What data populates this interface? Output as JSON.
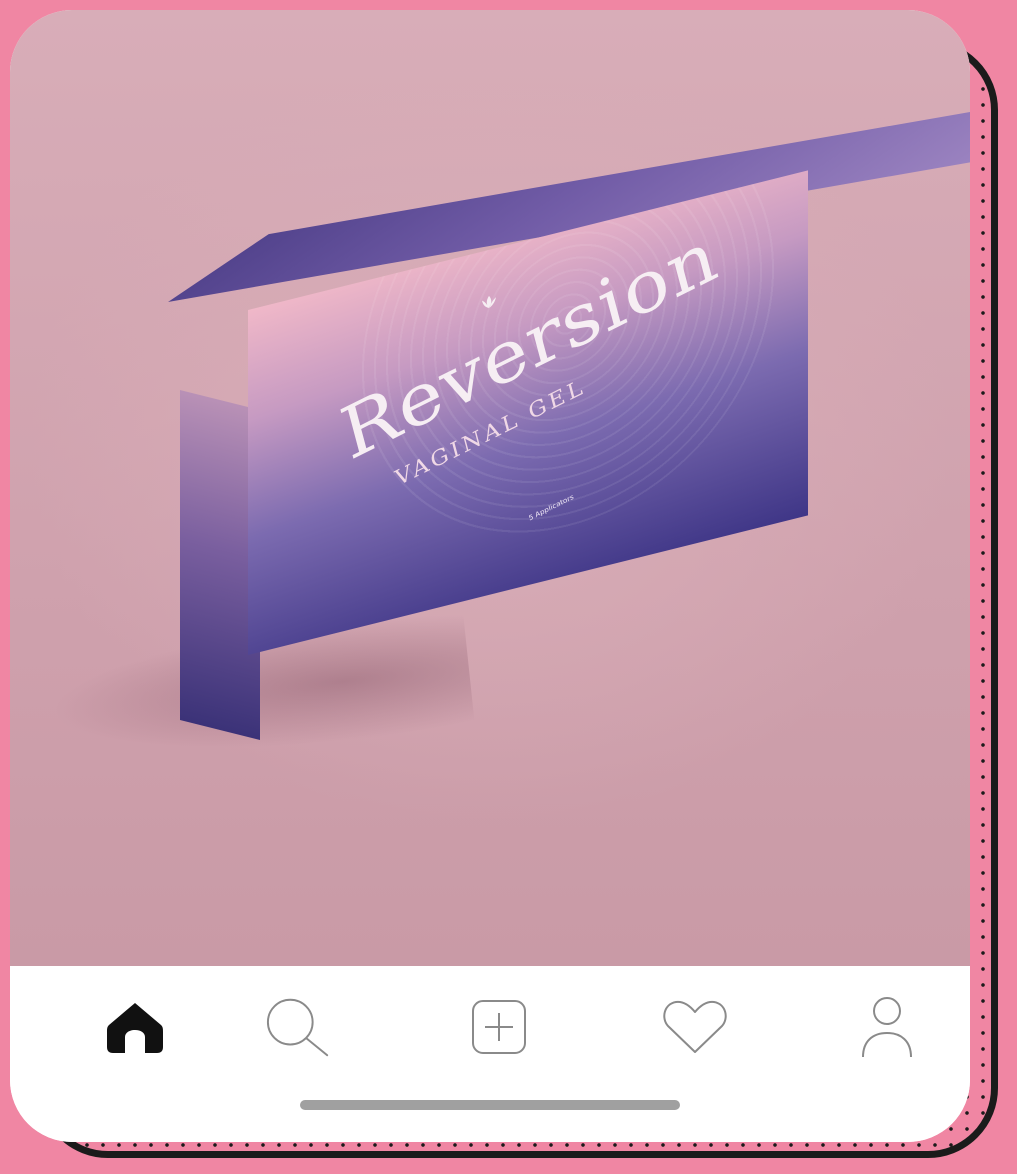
{
  "product": {
    "brand": "Reversion",
    "subtitle": "VAGINAL GEL",
    "small_print": "5 Applicators"
  },
  "nav": {
    "items": [
      {
        "name": "home",
        "icon": "home-icon",
        "active": true
      },
      {
        "name": "search",
        "icon": "search-icon",
        "active": false
      },
      {
        "name": "create",
        "icon": "add-post-icon",
        "active": false
      },
      {
        "name": "activity",
        "icon": "heart-icon",
        "active": false
      },
      {
        "name": "profile",
        "icon": "profile-icon",
        "active": false
      }
    ]
  },
  "colors": {
    "page_background": "#f086a3",
    "border": "#1b1b1b",
    "nav_active": "#111111",
    "nav_inactive": "#8a8a8a"
  }
}
